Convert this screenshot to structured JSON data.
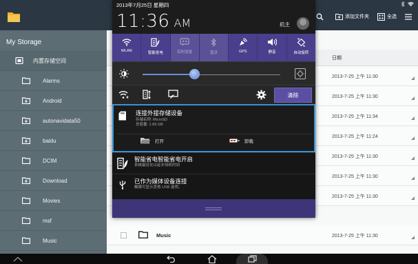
{
  "colors": {
    "titlebar": "#2b3843",
    "sidebar": "#5d6d74",
    "shade_accent": "#4a3f8c",
    "highlight_border": "#3a93d8",
    "clear_button": "#5a4fa3"
  },
  "icons": {
    "app_logo": "folder-icon",
    "search": "search-icon",
    "new_folder": "new-folder-icon",
    "select_all": "select-all-icon",
    "menu": "menu-icon"
  },
  "app": {
    "toolbar": {
      "new_folder_label": "添加文件夹",
      "select_all_label": "全选"
    },
    "sidebar": {
      "title": "My Storage",
      "internal_label": "内置存储空间",
      "folders": [
        "Alarms",
        "Android",
        "autonavidata50",
        "baidu",
        "DCIM",
        "Download",
        "Movies",
        "msf",
        "Music"
      ]
    },
    "list": {
      "date_header": "日期",
      "rows": [
        {
          "name": "",
          "date": "2013-7-25 上午 11:30"
        },
        {
          "name": "",
          "date": "2013-7-25 上午 11:30"
        },
        {
          "name": "",
          "date": "2013-7-25 上午 11:34"
        },
        {
          "name": "",
          "date": "2013-7-25 上午 11:24"
        },
        {
          "name": "",
          "date": "2013-7-25 上午 11:30"
        },
        {
          "name": "",
          "date": "2013-7-25 上午 11:30"
        },
        {
          "name": "",
          "date": "2013-7-25 上午 11:30"
        },
        {
          "name": "Music",
          "date": "2013-7-25 上午 11:30"
        }
      ]
    }
  },
  "shade": {
    "date": "2013年7月25日 星期四",
    "time": "11:36",
    "ampm": "AM",
    "owner": "机主",
    "quick_settings": [
      {
        "label": "WLAN",
        "icon": "wifi-icon",
        "on": true
      },
      {
        "label": "智能省电",
        "icon": "power-saver-icon",
        "on": true
      },
      {
        "label": "实时消息",
        "icon": "instant-message-icon",
        "on": false
      },
      {
        "label": "蓝牙",
        "icon": "bluetooth-icon",
        "on": false
      },
      {
        "label": "GPS",
        "icon": "gps-icon",
        "on": true
      },
      {
        "label": "静音",
        "icon": "mute-icon",
        "on": true
      },
      {
        "label": "自动旋转",
        "icon": "auto-rotate-icon",
        "on": true
      }
    ],
    "brightness_level": 0.38,
    "clear_label": "清除",
    "notifications": {
      "storage": {
        "title": "连接外接存储设备",
        "line1": "存储名称: MicroSD",
        "line2": "总容量: 1.89 GB",
        "open_label": "打开",
        "eject_label": "卸载"
      },
      "power": {
        "title": "智能省电智能省电开启",
        "sub": "系统最佳化以延长待机时间"
      },
      "usb": {
        "title": "已作为媒体设备连接",
        "sub": "触摸可显示其他 USB 选项。"
      }
    }
  }
}
